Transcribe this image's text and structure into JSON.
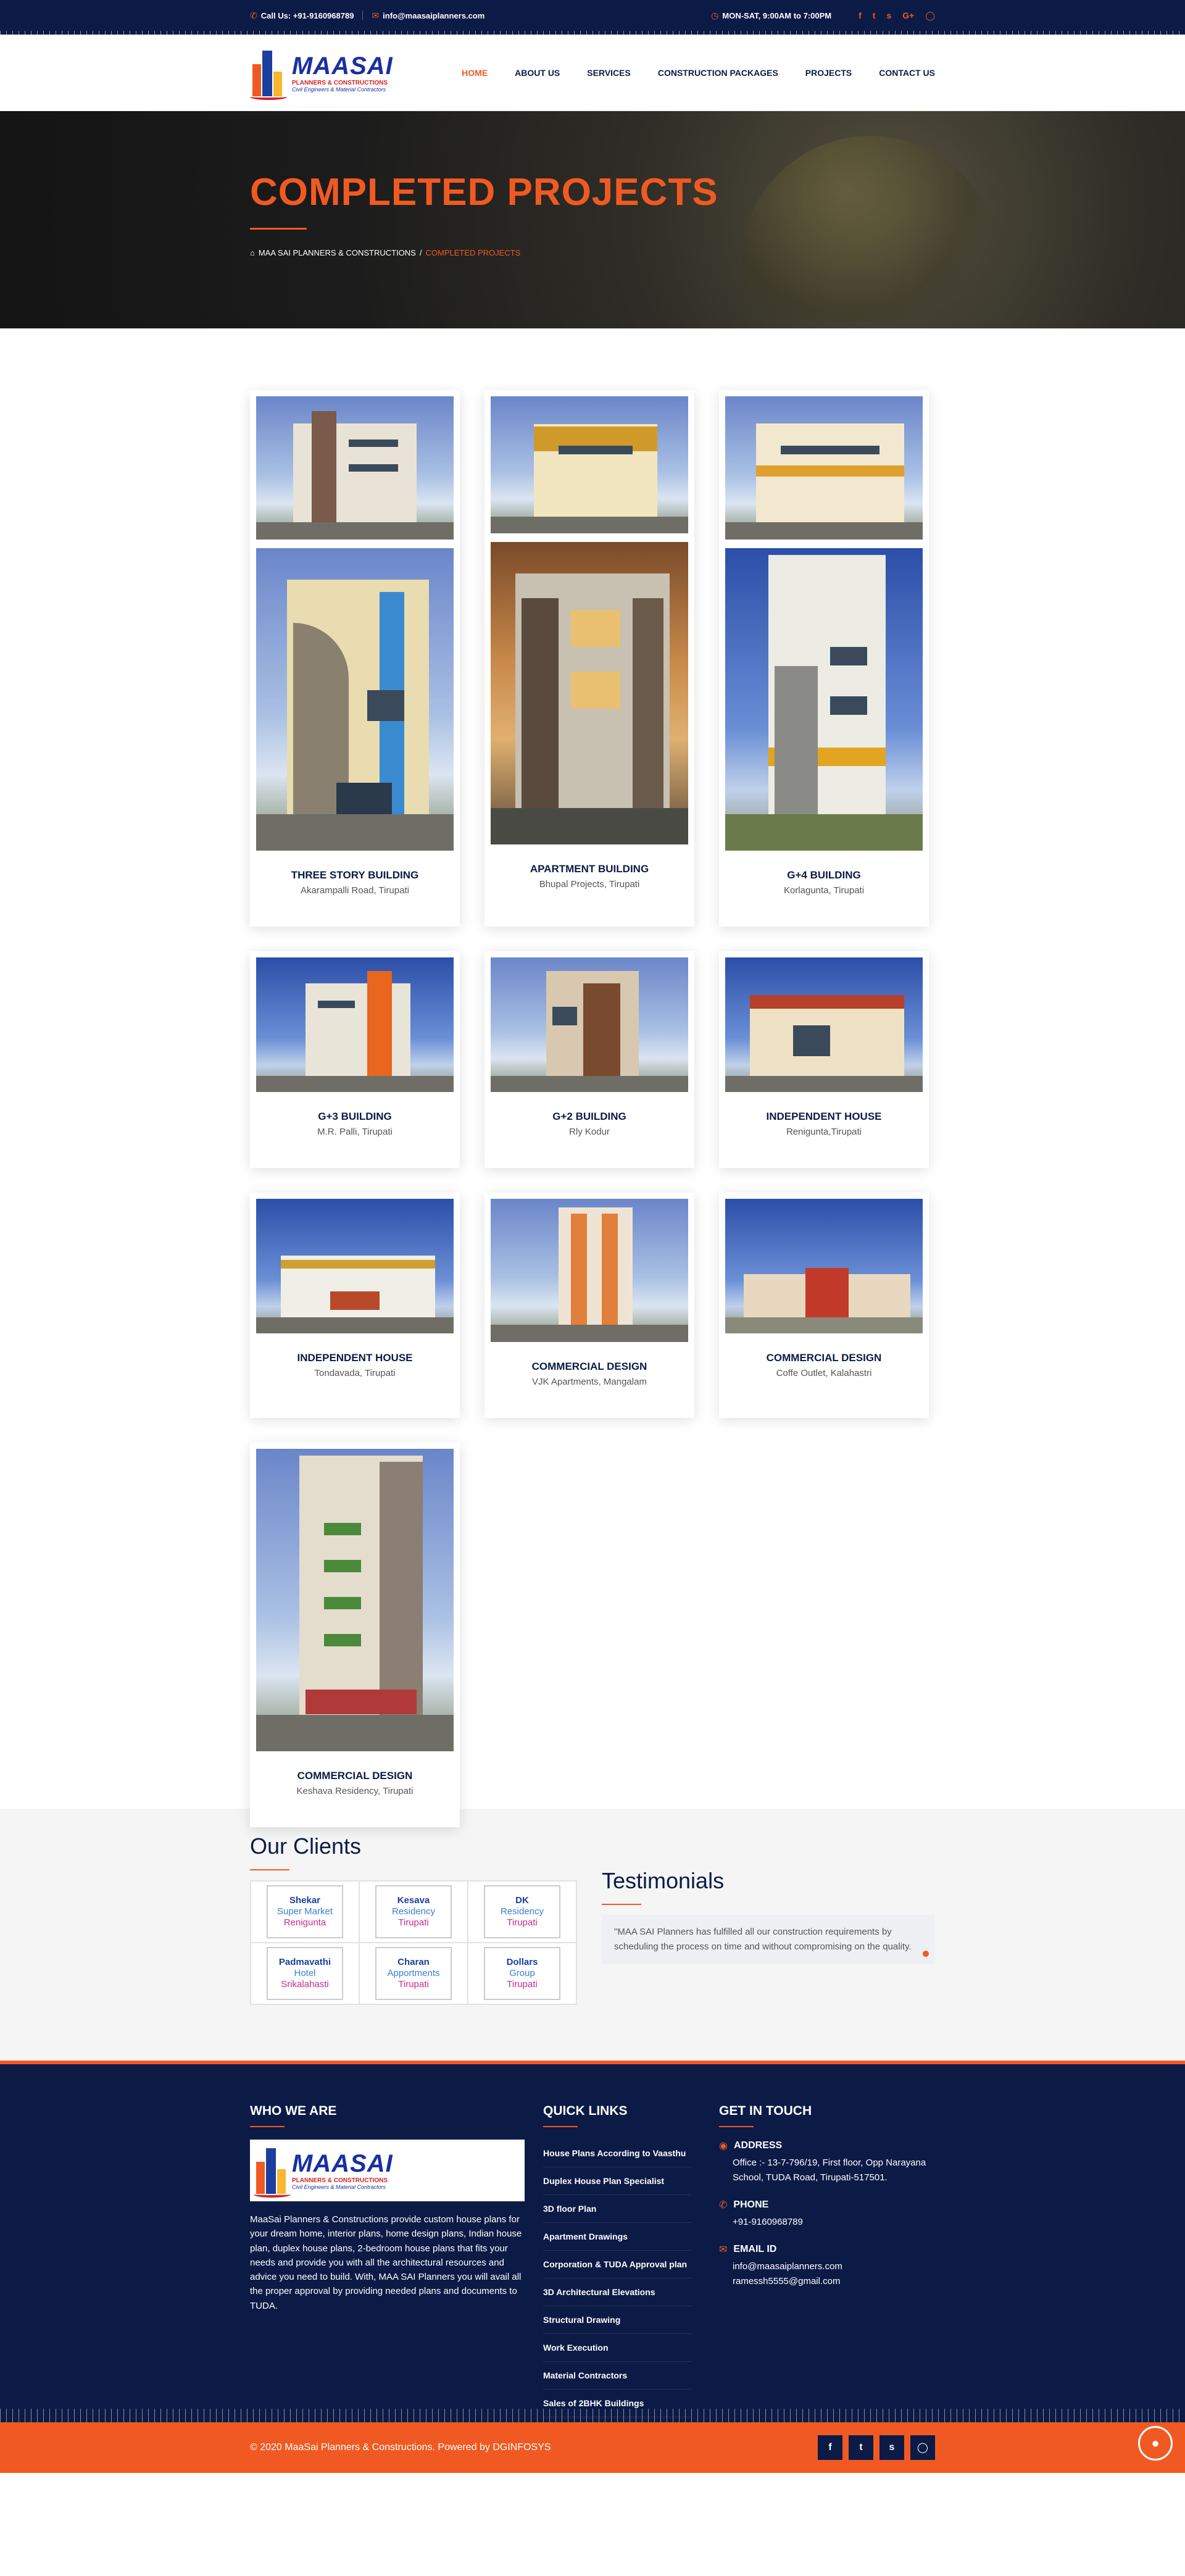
{
  "topbar": {
    "phone": "Call Us: +91-9160968789",
    "email": "info@maasaiplanners.com",
    "hours": "MON-SAT, 9:00AM to 7:00PM",
    "social_icons": [
      "facebook-icon",
      "twitter-icon",
      "skype-icon",
      "google-plus-icon",
      "instagram-icon"
    ]
  },
  "logo": {
    "name": "MAASAI",
    "line1": "PLANNERS & CONSTRUCTIONS",
    "line2": "Civil Engineers & Material Contractors"
  },
  "nav": {
    "items": [
      "HOME",
      "ABOUT US",
      "SERVICES",
      "CONSTRUCTION PACKAGES",
      "PROJECTS",
      "CONTACT US"
    ],
    "active": "HOME"
  },
  "hero": {
    "title": "COMPLETED PROJECTS",
    "breadcrumb_home": "MAA SAI PLANNERS & CONSTRUCTIONS",
    "breadcrumb_sep": "/",
    "breadcrumb_current": "COMPLETED PROJECTS"
  },
  "projects": [
    {
      "title": "THREE STORY BUILDING",
      "location": "Akarampalli Road, Tirupati"
    },
    {
      "title": "APARTMENT BUILDING",
      "location": "Bhupal Projects, Tirupati"
    },
    {
      "title": "G+4 BUILDING",
      "location": "Korlagunta, Tirupati"
    },
    {
      "title": "G+3 BUILDING",
      "location": "M.R. Palli, Tirupati"
    },
    {
      "title": "G+2 BUILDING",
      "location": "Rly Kodur"
    },
    {
      "title": "INDEPENDENT HOUSE",
      "location": "Renigunta,Tirupati"
    },
    {
      "title": "INDEPENDENT HOUSE",
      "location": "Tondavada, Tirupati"
    },
    {
      "title": "COMMERCIAL DESIGN",
      "location": "VJK Apartments, Mangalam"
    },
    {
      "title": "COMMERCIAL DESIGN",
      "location": "Coffe Outlet, Kalahastri"
    },
    {
      "title": "COMMERCIAL DESIGN",
      "location": "Keshava Residency, Tirupati"
    }
  ],
  "clients": {
    "title": "Our Clients",
    "items": [
      {
        "n1": "Shekar",
        "n2": "Super Market",
        "n3": "Renigunta"
      },
      {
        "n1": "Kesava",
        "n2": "Residency",
        "n3": "Tirupati"
      },
      {
        "n1": "DK",
        "n2": "Residency",
        "n3": "Tirupati"
      },
      {
        "n1": "Padmavathi",
        "n2": "Hotel",
        "n3": "Srikalahasti"
      },
      {
        "n1": "Charan",
        "n2": "Apportments",
        "n3": "Tirupati"
      },
      {
        "n1": "Dollars",
        "n2": "Group",
        "n3": "Tirupati"
      }
    ]
  },
  "testimonials": {
    "title": "Testimonials",
    "quote": "\"MAA SAI Planners has fulfilled all our construction requirements by scheduling the process on time and without compromising on the quality."
  },
  "footer": {
    "who_title": "WHO WE ARE",
    "who_text": "MaaSai Planners & Constructions provide custom house plans for your dream home, interior plans, home design plans, Indian house plan, duplex house plans, 2-bedroom house plans that fits your needs and provide you with all the architectural resources and advice you need to build. With, MAA SAI Planners you will avail all the proper approval by providing needed plans and documents to TUDA.",
    "quick_title": "QUICK LINKS",
    "quick_links": [
      "House Plans According to Vaasthu",
      "Duplex House Plan Specialist",
      "3D floor Plan",
      "Apartment Drawings",
      "Corporation & TUDA Approval plan",
      "3D Architectural Elevations",
      "Structural Drawing",
      "Work Execution",
      "Material Contractors",
      "Sales of 2BHK Buildings"
    ],
    "touch_title": "GET IN TOUCH",
    "address_label": "ADDRESS",
    "address": "Office :- 13-7-796/19, First floor, Opp Narayana School, TUDA Road, Tirupati-517501.",
    "phone_label": "PHONE",
    "phone": "+91-9160968789",
    "email_label": "EMAIL ID",
    "email1": "info@maasaiplanners.com",
    "email2": "ramessh5555@gmail.com"
  },
  "bottom": {
    "copyright": "© 2020 MaaSai Planners & Constructions. Powered by DGINFOSYS",
    "social_icons": [
      "facebook-icon",
      "twitter-icon",
      "skype-icon",
      "instagram-icon"
    ]
  },
  "colors": {
    "navy": "#0c1b46",
    "accent": "#f05a22"
  }
}
